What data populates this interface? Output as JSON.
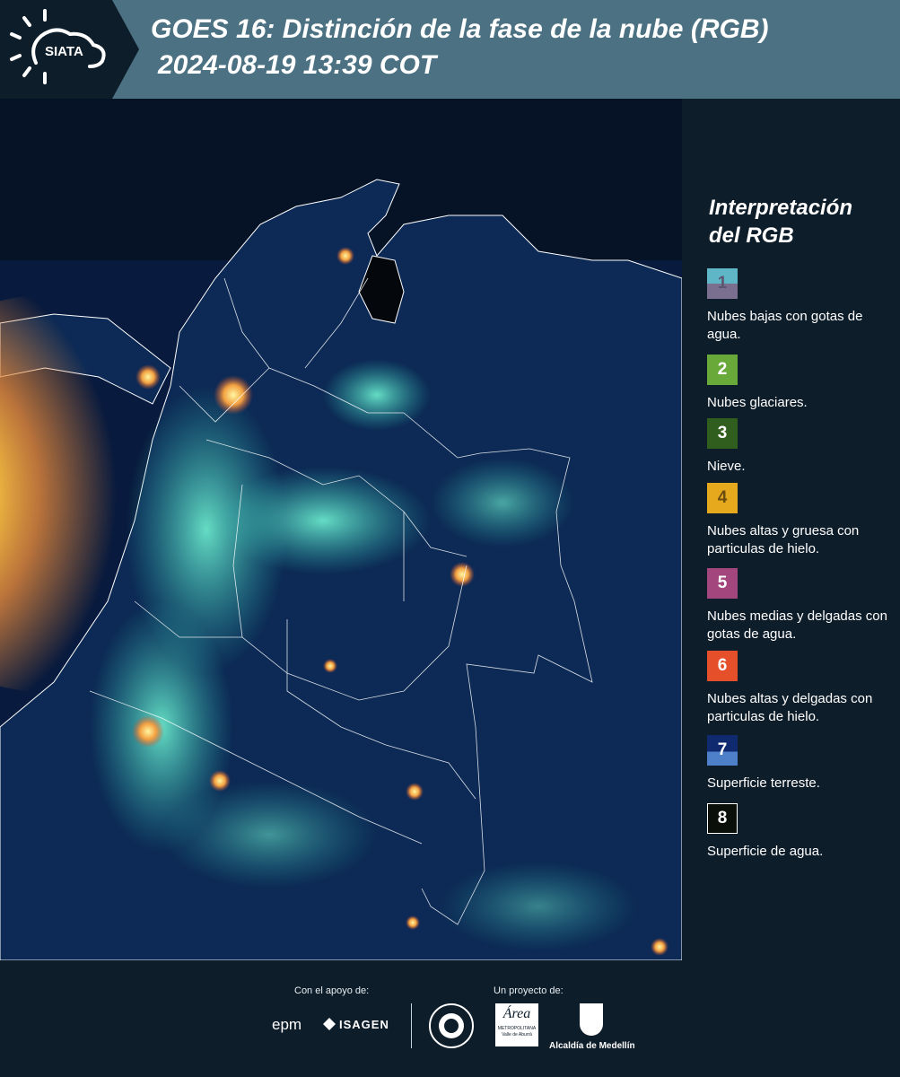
{
  "header": {
    "logo_text": "SIATA",
    "title_line1": "GOES 16: Distinción de la fase de la nube (RGB)",
    "title_line2": "2024-08-19 13:39 COT"
  },
  "legend": {
    "title_line1": "Interpretación",
    "title_line2": "del RGB",
    "items": [
      {
        "number": "1",
        "label": "Nubes bajas con gotas de agua.",
        "color_top": "#5fb6c6",
        "color_bottom": "#7a6f8e",
        "number_color": "#5b5670"
      },
      {
        "number": "2",
        "label": "Nubes glaciares.",
        "color": "#69a93a",
        "number_color": "#ffffff"
      },
      {
        "number": "3",
        "label": "Nieve.",
        "color": "#2f5e1e",
        "number_color": "#ffffff"
      },
      {
        "number": "4",
        "label": "Nubes altas y gruesa con particulas de hielo.",
        "color": "#e6a81c",
        "number_color": "#6b4d10"
      },
      {
        "number": "5",
        "label": "Nubes medias y delgadas con gotas de agua.",
        "color": "#a3467d",
        "number_color": "#ffffff"
      },
      {
        "number": "6",
        "label": "Nubes altas y delgadas con particulas de hielo.",
        "color": "#e5502a",
        "number_color": "#ffffff"
      },
      {
        "number": "7",
        "label": "Superficie terreste.",
        "color_top": "#0f2a6e",
        "color_bottom": "#4e7fc9",
        "number_color": "#ffffff"
      },
      {
        "number": "8",
        "label": "Superficie de agua.",
        "color": "#0a0f0a",
        "number_color": "#ffffff"
      }
    ]
  },
  "footer": {
    "support_caption": "Con el apoyo de:",
    "project_caption": "Un proyecto de:",
    "logo_epm": "epm",
    "logo_isagen": "ISAGEN",
    "logo_area": "Área",
    "logo_area_sub": "METROPOLITANA",
    "logo_area_sub2": "Valle de Aburrá",
    "logo_alcaldia": "Alcaldía de Medellín"
  },
  "colors": {
    "background": "#0e1d2a",
    "header_band": "#4b7182",
    "ocean": "#0a1833",
    "land": "#0c2a52",
    "cloud_cyan": "#3ce0c8",
    "cloud_yellow": "#f6e24a",
    "cloud_orange": "#f08a3a"
  }
}
